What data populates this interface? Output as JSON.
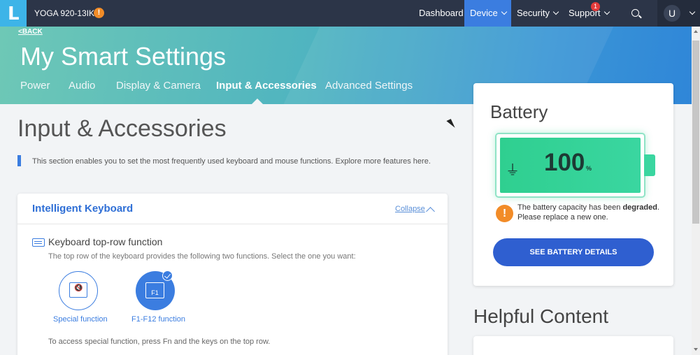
{
  "topnav": {
    "device_model": "YOGA 920-13IKB",
    "warning_glyph": "!",
    "items": [
      {
        "label": "Dashboard"
      },
      {
        "label": "Device"
      },
      {
        "label": "Security"
      },
      {
        "label": "Support"
      }
    ],
    "support_badge": "1",
    "user_initial": "U",
    "logo_letter": "L"
  },
  "banner": {
    "back_label": "<BACK",
    "title": "My Smart Settings",
    "tabs": [
      {
        "label": "Power"
      },
      {
        "label": "Audio"
      },
      {
        "label": "Display & Camera"
      },
      {
        "label": "Input & Accessories"
      },
      {
        "label": "Advanced Settings"
      }
    ]
  },
  "main": {
    "section_title": "Input & Accessories",
    "description": "This section enables you to set the most frequently used keyboard and mouse functions. Explore more features here.",
    "card": {
      "title": "Intelligent Keyboard",
      "collapse_label": "Collapse",
      "feature_title": "Keyboard top-row function",
      "feature_sub": "The top row of the keyboard provides the following two functions. Select the one you want:",
      "options": [
        {
          "label": "Special function"
        },
        {
          "label": "F1-F12 function",
          "key_text": "F1"
        }
      ],
      "access_note": "To access special function, press Fn and the keys on the top row."
    }
  },
  "battery": {
    "title": "Battery",
    "value": "100",
    "unit": "%",
    "warning_prefix": "The battery capacity has been ",
    "warning_bold": "degraded",
    "warning_suffix": ". Please replace a new one.",
    "button_label": "SEE BATTERY DETAILS"
  },
  "helpful": {
    "title": "Helpful Content"
  },
  "colors": {
    "nav_bg": "#2c3548",
    "accent": "#3b7de0",
    "battery_green": "#3ad6a0",
    "warning": "#f28c28"
  }
}
